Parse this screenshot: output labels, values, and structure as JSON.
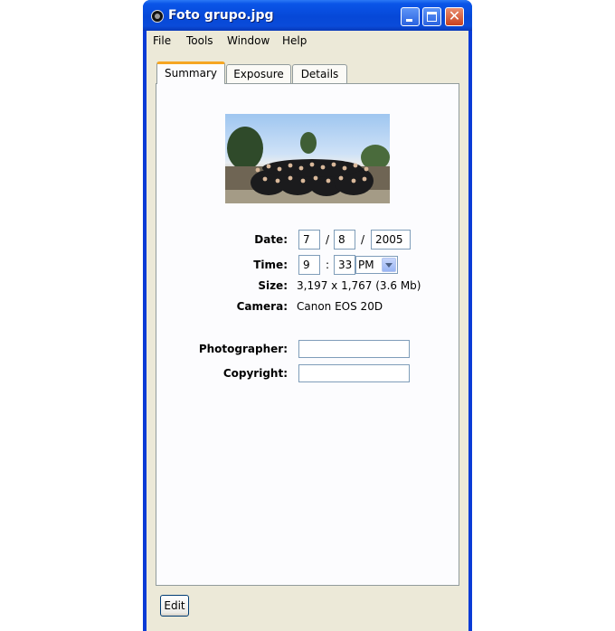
{
  "window": {
    "title": "Foto grupo.jpg"
  },
  "menu": {
    "file": "File",
    "tools": "Tools",
    "window": "Window",
    "help": "Help"
  },
  "tabs": {
    "summary": "Summary",
    "exposure": "Exposure",
    "details": "Details"
  },
  "summary": {
    "date_label": "Date:",
    "date_month": "7",
    "date_day": "8",
    "date_year": "2005",
    "date_sep": "/",
    "time_label": "Time:",
    "time_hour": "9",
    "time_sep": ":",
    "time_minute": "33",
    "time_ampm": "PM",
    "size_label": "Size:",
    "size_value": "3,197 x 1,767 (3.6 Mb)",
    "camera_label": "Camera:",
    "camera_value": "Canon EOS 20D",
    "photographer_label": "Photographer:",
    "photographer_value": "",
    "copyright_label": "Copyright:",
    "copyright_value": ""
  },
  "buttons": {
    "edit": "Edit"
  },
  "colors": {
    "titlebar": "#0648d8",
    "client": "#ece9d8",
    "active_tab_accent": "#f5a623",
    "close_button": "#c9421f"
  },
  "icons": {
    "app": "camera-lens-icon",
    "minimize": "minimize-icon",
    "maximize": "maximize-icon",
    "close": "close-icon",
    "dropdown": "chevron-down-icon"
  }
}
